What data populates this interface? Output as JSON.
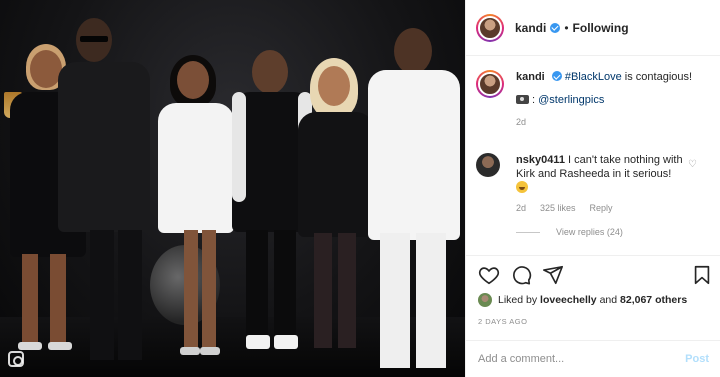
{
  "post": {
    "author": "kandi",
    "follow_status": "Following",
    "header_separator": "•"
  },
  "caption": {
    "username": "kandi",
    "hashtag": "#BlackLove",
    "text": " is contagious!",
    "credit_icon": "camera-icon",
    "credit_separator": ":",
    "mention": "@sterlingpics",
    "time": "2d"
  },
  "comment": {
    "username": "nsky0411",
    "text": " I can't take nothing with Kirk and Rasheeda in it serious!",
    "emoji": "laughing-face-emoji",
    "time": "2d",
    "likes": "325 likes",
    "reply_label": "Reply",
    "view_replies": "View replies (24)"
  },
  "actions": {
    "icons": [
      "heart-icon",
      "comment-icon",
      "share-icon",
      "bookmark-icon"
    ],
    "liked_by_prefix": "Liked by ",
    "liked_by_user": "loveechelly",
    "liked_by_joiner": " and ",
    "liked_by_count": "82,067 others",
    "time_ago": "2 DAYS AGO"
  },
  "add_comment": {
    "placeholder": "Add a comment...",
    "post_label": "Post"
  },
  "colors": {
    "link": "#00376b",
    "verified": "#3897f0",
    "muted": "#8e8e8e",
    "post_disabled": "#b2dffc"
  }
}
